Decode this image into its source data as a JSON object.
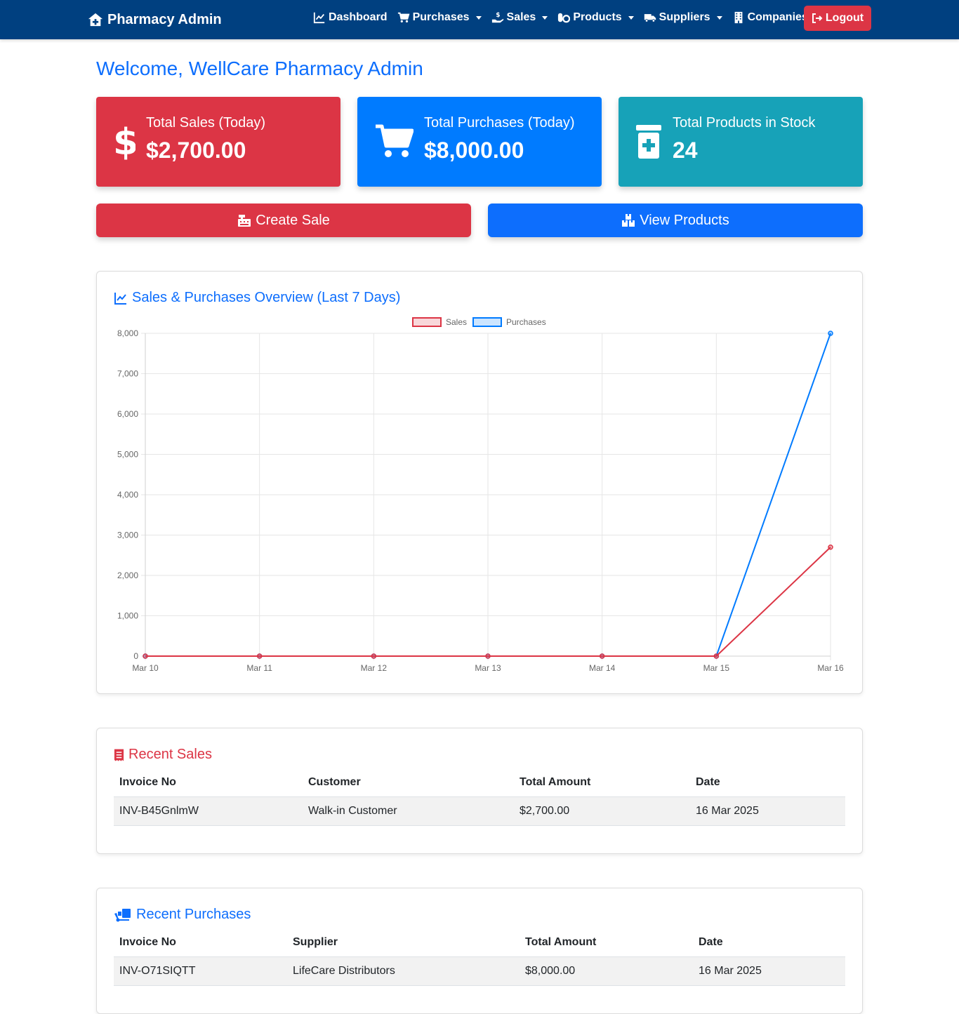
{
  "navbar": {
    "brand": "Pharmacy Admin",
    "items": [
      {
        "label": "Dashboard",
        "icon": "chart-line-icon",
        "dropdown": false
      },
      {
        "label": "Purchases",
        "icon": "cart-icon",
        "dropdown": true
      },
      {
        "label": "Sales",
        "icon": "hand-holding-dollar-icon",
        "dropdown": true
      },
      {
        "label": "Products",
        "icon": "pills-icon",
        "dropdown": true
      },
      {
        "label": "Suppliers",
        "icon": "truck-icon",
        "dropdown": true
      },
      {
        "label": "Companies",
        "icon": "building-icon",
        "dropdown": true
      }
    ],
    "logout_label": "Logout"
  },
  "welcome": "Welcome, WellCare Pharmacy Admin",
  "stats": {
    "sales": {
      "label": "Total Sales (Today)",
      "value": "$2,700.00",
      "icon": "dollar-icon",
      "color": "#dc3545"
    },
    "purchases": {
      "label": "Total Purchases (Today)",
      "value": "$8,000.00",
      "icon": "cart-icon",
      "color": "#007bff"
    },
    "products": {
      "label": "Total Products in Stock",
      "value": "24",
      "icon": "prescription-bottle-icon",
      "color": "#17a2b8"
    }
  },
  "actions": {
    "create_sale": "Create Sale",
    "view_products": "View Products"
  },
  "chart_card": {
    "title": "Sales & Purchases Overview (Last 7 Days)"
  },
  "chart_data": {
    "type": "line",
    "categories": [
      "Mar 10",
      "Mar 11",
      "Mar 12",
      "Mar 13",
      "Mar 14",
      "Mar 15",
      "Mar 16"
    ],
    "series": [
      {
        "name": "Sales",
        "values": [
          0,
          0,
          0,
          0,
          0,
          0,
          2700
        ],
        "color": "#dc3545"
      },
      {
        "name": "Purchases",
        "values": [
          0,
          0,
          0,
          0,
          0,
          0,
          8000
        ],
        "color": "#007bff"
      }
    ],
    "yticks": [
      "0",
      "1,000",
      "2,000",
      "3,000",
      "4,000",
      "5,000",
      "6,000",
      "7,000",
      "8,000"
    ],
    "ylim": [
      0,
      8000
    ],
    "grid": true,
    "legend": "top-center"
  },
  "recent_sales": {
    "title": "Recent Sales",
    "headers": [
      "Invoice No",
      "Customer",
      "Total Amount",
      "Date"
    ],
    "rows": [
      [
        "INV-B45GnlmW",
        "Walk-in Customer",
        "$2,700.00",
        "16 Mar 2025"
      ]
    ]
  },
  "recent_purchases": {
    "title": "Recent Purchases",
    "headers": [
      "Invoice No",
      "Supplier",
      "Total Amount",
      "Date"
    ],
    "rows": [
      [
        "INV-O71SIQTT",
        "LifeCare Distributors",
        "$8,000.00",
        "16 Mar 2025"
      ]
    ]
  }
}
